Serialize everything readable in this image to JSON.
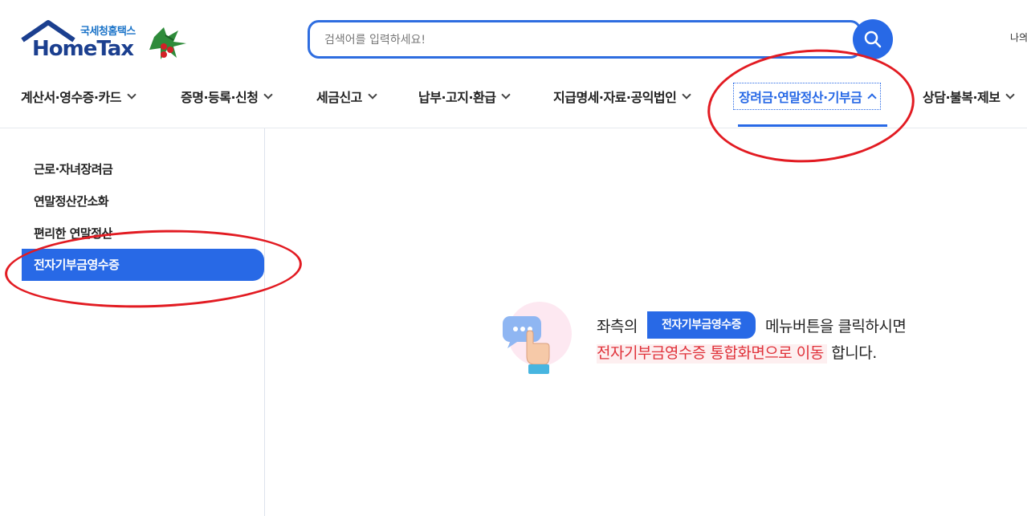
{
  "header": {
    "logo_sub": "국세청홈택스",
    "logo_main": "HomeTax",
    "search_placeholder": "검색어를 입력하세요!",
    "top_right_text": "나의"
  },
  "gnb": {
    "items": [
      {
        "label": "계산서·영수증·카드"
      },
      {
        "label": "증명·등록·신청"
      },
      {
        "label": "세금신고"
      },
      {
        "label": "납부·고지·환급"
      },
      {
        "label": "지급명세·자료·공익법인"
      },
      {
        "label": "장려금·연말정산·기부금",
        "active": true
      },
      {
        "label": "상담·불복·제보"
      }
    ]
  },
  "sidebar": {
    "items": [
      {
        "label": "근로·자녀장려금"
      },
      {
        "label": "연말정산간소화"
      },
      {
        "label": "편리한 연말정산"
      },
      {
        "label": "전자기부금영수증",
        "active": true
      }
    ]
  },
  "main": {
    "line1_prefix": "좌측의",
    "chip_label": "전자기부금영수증",
    "line1_suffix": "메뉴버튼을 클릭하시면",
    "line2_highlight": "전자기부금영수증 통합화면으로 이동",
    "line2_suffix": " 합니다."
  },
  "icons": {
    "search": "search-icon",
    "chevron_down": "chevron-down-icon",
    "chevron_up": "chevron-up-icon",
    "pointer": "hand-pointer-icon"
  },
  "colors": {
    "accent": "#2869e6",
    "highlight_red": "#e0323a",
    "annotation_red": "#e21b22",
    "logo_navy": "#1b3f8f"
  }
}
